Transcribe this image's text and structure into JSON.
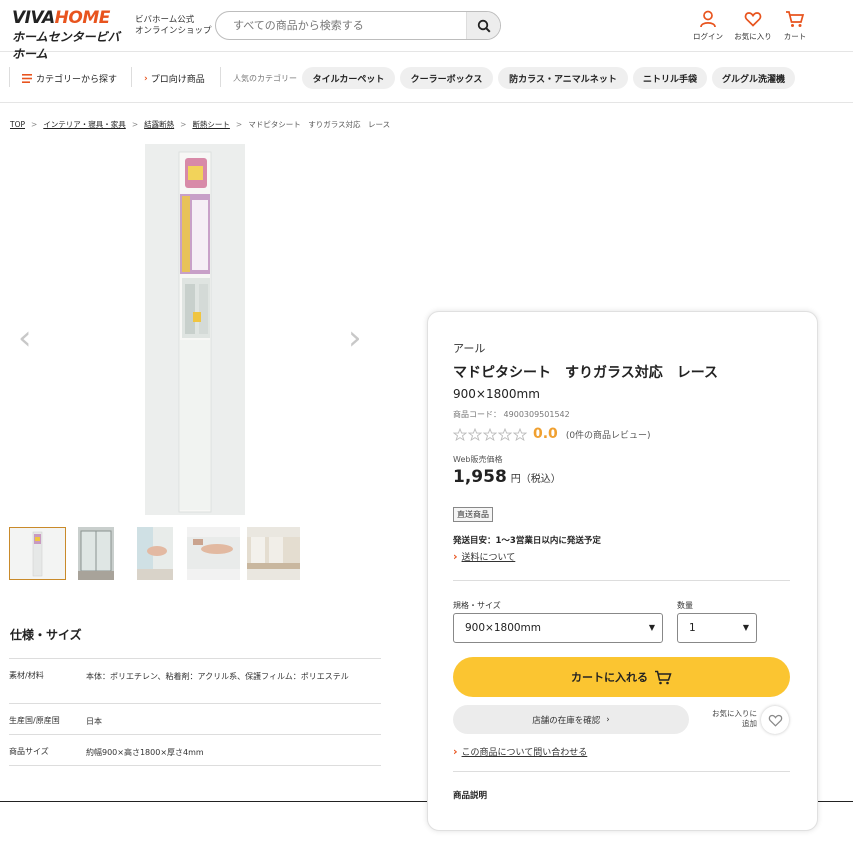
{
  "header": {
    "logo_top": "VIVAHOME",
    "logo_bottom": "ホームセンタービバホーム",
    "shop_sub_line1": "ビバホーム公式",
    "shop_sub_line2": "オンラインショップ",
    "search_placeholder": "すべての商品から検索する",
    "login_label": "ログイン",
    "favorites_label": "お気に入り",
    "cart_label": "カート",
    "accent_color": "#e8541e"
  },
  "nav": {
    "category_label": "カテゴリーから探す",
    "pro_label": "プロ向け商品",
    "popular_label": "人気のカテゴリー",
    "chips": [
      "タイルカーペット",
      "クーラーボックス",
      "防カラス・アニマルネット",
      "ニトリル手袋",
      "グルグル洗濯機"
    ]
  },
  "breadcrumb": {
    "items": [
      "TOP",
      "インテリア・寝具・家具",
      "結露断熱",
      "断熱シート"
    ],
    "current": "マドピタシート　すりガラス対応　レース"
  },
  "gallery": {
    "prev_arrow": "‹",
    "next_arrow": "›"
  },
  "specs": {
    "title": "仕様・サイズ",
    "rows": [
      {
        "key": "素材/材料",
        "value": "本体：ポリエチレン、粘着剤：アクリル系、保護フィルム：ポリエステル"
      },
      {
        "key": "生産国/原産国",
        "value": "日本"
      },
      {
        "key": "商品サイズ",
        "value": "約幅900×高さ1800×厚さ4mm"
      }
    ]
  },
  "product": {
    "brand": "アール",
    "name": "マドピタシート　すりガラス対応　レース",
    "size": "900×1800mm",
    "code_label": "商品コード：",
    "code": "4900309501542",
    "rating": "0.0",
    "review_text": "(0件の商品レビュー)",
    "price_label": "Web販売価格",
    "price": "1,958",
    "price_unit": "円（税込）",
    "tag": "直送商品",
    "ship_estimate": "発送目安：1〜3営業日以内に発送予定",
    "shipping_link": "送料について",
    "spec_select_label": "規格・サイズ",
    "spec_select_value": "900×1800mm",
    "qty_label": "数量",
    "qty_value": "1",
    "cart_button": "カートに入れる",
    "stock_button": "店舗の在庫を確認",
    "fav_line1": "お気に入りに",
    "fav_line2": "追加",
    "inquiry_link": "この商品について問い合わせる",
    "description_heading": "商品説明",
    "cart_button_color": "#fbc531",
    "rating_color": "#f0a030"
  }
}
